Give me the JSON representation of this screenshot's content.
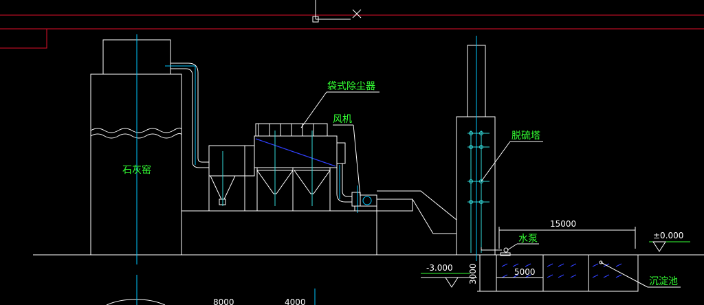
{
  "labels": {
    "kiln": "石灰窑",
    "bag_filter": "袋式除尘器",
    "fan": "风机",
    "desulfurization_tower": "脱硫塔",
    "water_pump": "水泵",
    "settling_tank": "沉淀池"
  },
  "dimensions": {
    "length_15000": "15000",
    "length_5000": "5000",
    "depth_3000": "3000",
    "elev_zero": "±0.000",
    "elev_minus": "-3.000",
    "bottom_8000": "8000",
    "bottom_4000": "4000"
  },
  "colors": {
    "background": "#000000",
    "linework": "#ffffff",
    "centerline": "#00c8ff",
    "label": "#33ff33",
    "border": "#e0102a",
    "baffle": "#3040ff"
  }
}
